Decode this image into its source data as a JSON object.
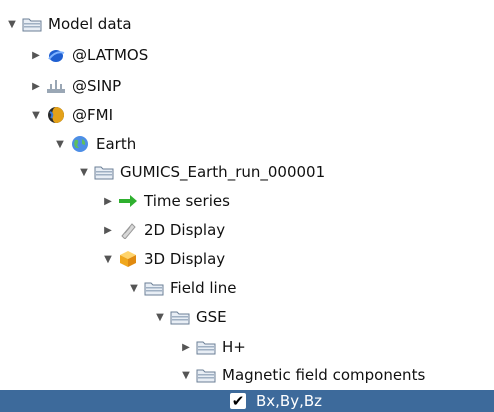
{
  "tree": {
    "nodes": [
      {
        "label": "Model data",
        "icon": "folder-icon",
        "expander": "expanded"
      },
      {
        "label": "@LATMOS",
        "icon": "latmos-icon",
        "expander": "collapsed"
      },
      {
        "label": "@SINP",
        "icon": "sinp-icon",
        "expander": "collapsed"
      },
      {
        "label": "@FMI",
        "icon": "fmi-globe-icon",
        "expander": "expanded"
      },
      {
        "label": "Earth",
        "icon": "earth-icon",
        "expander": "expanded"
      },
      {
        "label": "GUMICS_Earth_run_000001",
        "icon": "folder-icon",
        "expander": "expanded"
      },
      {
        "label": "Time series",
        "icon": "time-series-arrow-icon",
        "expander": "collapsed"
      },
      {
        "label": "2D Display",
        "icon": "2d-display-icon",
        "expander": "collapsed"
      },
      {
        "label": "3D Display",
        "icon": "3d-display-cube-icon",
        "expander": "expanded"
      },
      {
        "label": "Field line",
        "icon": "folder-icon",
        "expander": "expanded"
      },
      {
        "label": "GSE",
        "icon": "folder-icon",
        "expander": "expanded"
      },
      {
        "label": "H+",
        "icon": "folder-icon",
        "expander": "collapsed"
      },
      {
        "label": "Magnetic field components",
        "icon": "folder-icon",
        "expander": "expanded"
      },
      {
        "label": "Bx,By,Bz",
        "icon": "checkmark-icon",
        "expander": "none",
        "selected": true
      }
    ]
  },
  "colors": {
    "selection_background": "#3d6a9b",
    "arrow_green": "#2fb02f",
    "folder_top": "#e8eef5",
    "folder_border": "#6b7f96"
  }
}
